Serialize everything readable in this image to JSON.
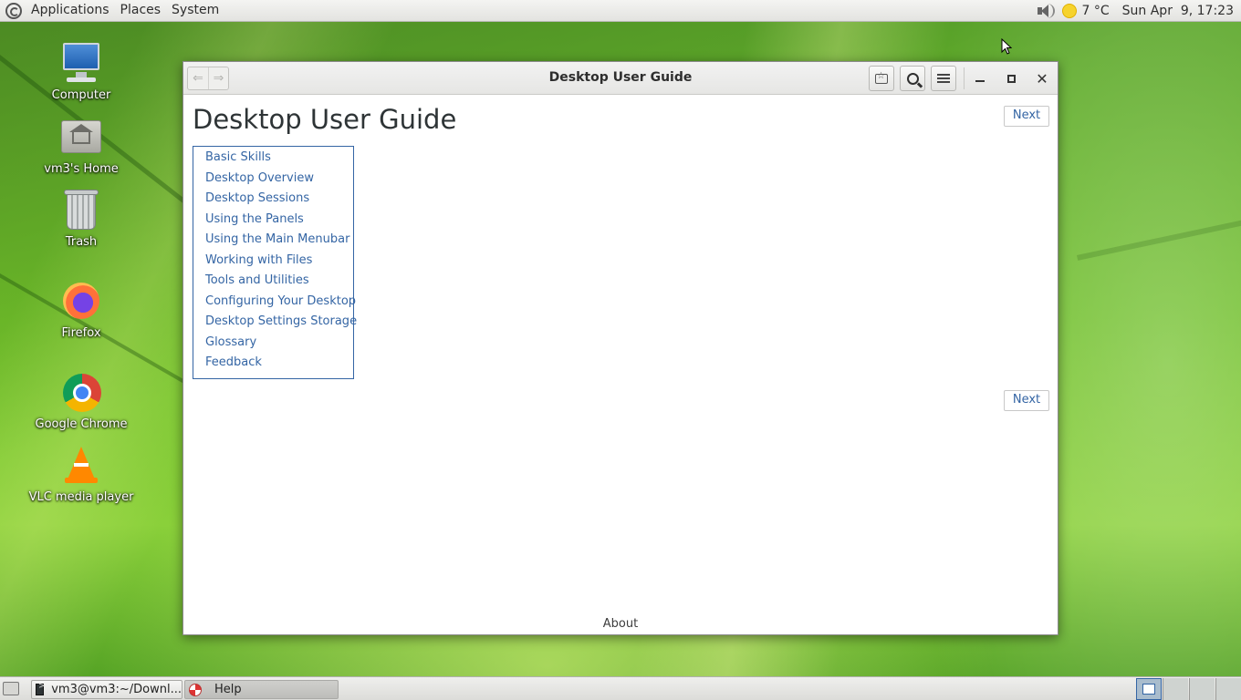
{
  "top_panel": {
    "menus": [
      "Applications",
      "Places",
      "System"
    ],
    "weather": "7 °C",
    "clock": "Sun Apr  9, 17:23"
  },
  "desktop_icons": [
    {
      "label": "Computer",
      "icon": "computer-icon"
    },
    {
      "label": "vm3's Home",
      "icon": "home-folder-icon"
    },
    {
      "label": "Trash",
      "icon": "trash-icon"
    },
    {
      "label": "Firefox",
      "icon": "firefox-icon"
    },
    {
      "label": "Google Chrome",
      "icon": "chrome-icon"
    },
    {
      "label": "VLC media player",
      "icon": "vlc-icon"
    }
  ],
  "window": {
    "title": "Desktop User Guide",
    "heading": "Desktop User Guide",
    "next_label": "Next",
    "toc": [
      "Basic Skills",
      "Desktop Overview",
      "Desktop Sessions",
      "Using the Panels",
      "Using the Main Menubar",
      "Working with Files",
      "Tools and Utilities",
      "Configuring Your Desktop",
      "Desktop Settings Storage",
      "Glossary",
      "Feedback"
    ],
    "footer_link": "About"
  },
  "taskbar": {
    "tasks": [
      {
        "label": "vm3@vm3:~/Downl...",
        "icon": "terminal-icon"
      },
      {
        "label": "Help",
        "icon": "help-icon"
      }
    ]
  }
}
